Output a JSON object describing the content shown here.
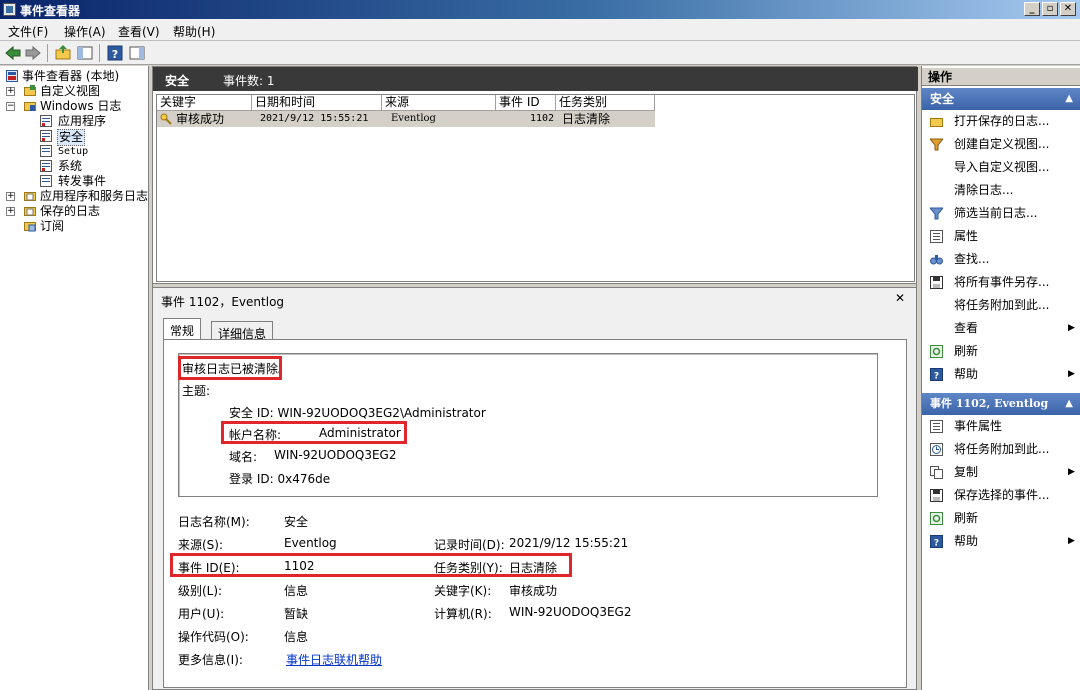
{
  "window": {
    "title": "事件查看器",
    "buttons": [
      "_",
      "▫",
      "✕"
    ]
  },
  "menu": [
    "文件(F)",
    "操作(A)",
    "查看(V)",
    "帮助(H)"
  ],
  "tree": {
    "root": "事件查看器 (本地)",
    "custom_views": "自定义视图",
    "windows_logs": "Windows 日志",
    "logs": [
      "应用程序",
      "安全",
      "Setup",
      "系统",
      "转发事件"
    ],
    "app_services": "应用程序和服务日志",
    "saved_logs": "保存的日志",
    "subscriptions": "订阅"
  },
  "center": {
    "header_title": "安全",
    "header_count": "事件数: 1",
    "columns": [
      "关键字",
      "日期和时间",
      "来源",
      "事件 ID",
      "任务类别"
    ],
    "rows": [
      {
        "keyword": "审核成功",
        "datetime": "2021/9/12 15:55:21",
        "source": "Eventlog",
        "event_id": "1102",
        "category": "日志清除"
      }
    ]
  },
  "detail": {
    "title": "事件 1102，Eventlog",
    "close": "✕",
    "tabs": [
      "常规",
      "详细信息"
    ],
    "message": "审核日志已被清除。",
    "subject_label": "主题:",
    "security_id": "安全 ID:  WIN-92UODOQ3EG2\\Administrator",
    "account_label": "帐户名称:",
    "account_value": "Administrator",
    "domain_label": "域名:",
    "domain_value": "WIN-92UODOQ3EG2",
    "logon_id": "登录 ID: 0x476de",
    "fields": {
      "log_name_label": "日志名称(M):",
      "log_name": "安全",
      "source_label": "来源(S):",
      "source": "Eventlog",
      "logged_label": "记录时间(D):",
      "logged": "2021/9/12 15:55:21",
      "event_id_label": "事件 ID(E):",
      "event_id": "1102",
      "task_label": "任务类别(Y):",
      "task": "日志清除",
      "level_label": "级别(L):",
      "level": "信息",
      "keywords_label": "关键字(K):",
      "keywords": "审核成功",
      "user_label": "用户(U):",
      "user": "暂缺",
      "computer_label": "计算机(R):",
      "computer": "WIN-92UODOQ3EG2",
      "opcode_label": "操作代码(O):",
      "opcode": "信息",
      "more_label": "更多信息(I):",
      "more_link": "事件日志联机帮助"
    }
  },
  "actions": {
    "title": "操作",
    "section1": "安全",
    "items1": [
      "打开保存的日志...",
      "创建自定义视图...",
      "导入自定义视图...",
      "清除日志...",
      "筛选当前日志...",
      "属性",
      "查找...",
      "将所有事件另存...",
      "将任务附加到此...",
      "查看",
      "刷新",
      "帮助"
    ],
    "section2": "事件 1102, Eventlog",
    "items2": [
      "事件属性",
      "将任务附加到此...",
      "复制",
      "保存选择的事件...",
      "刷新",
      "帮助"
    ]
  },
  "colors": {
    "highlight": "#e0262a",
    "header_dark": "#393939",
    "section_blue": "#3b63a8",
    "link": "#0033cc"
  }
}
